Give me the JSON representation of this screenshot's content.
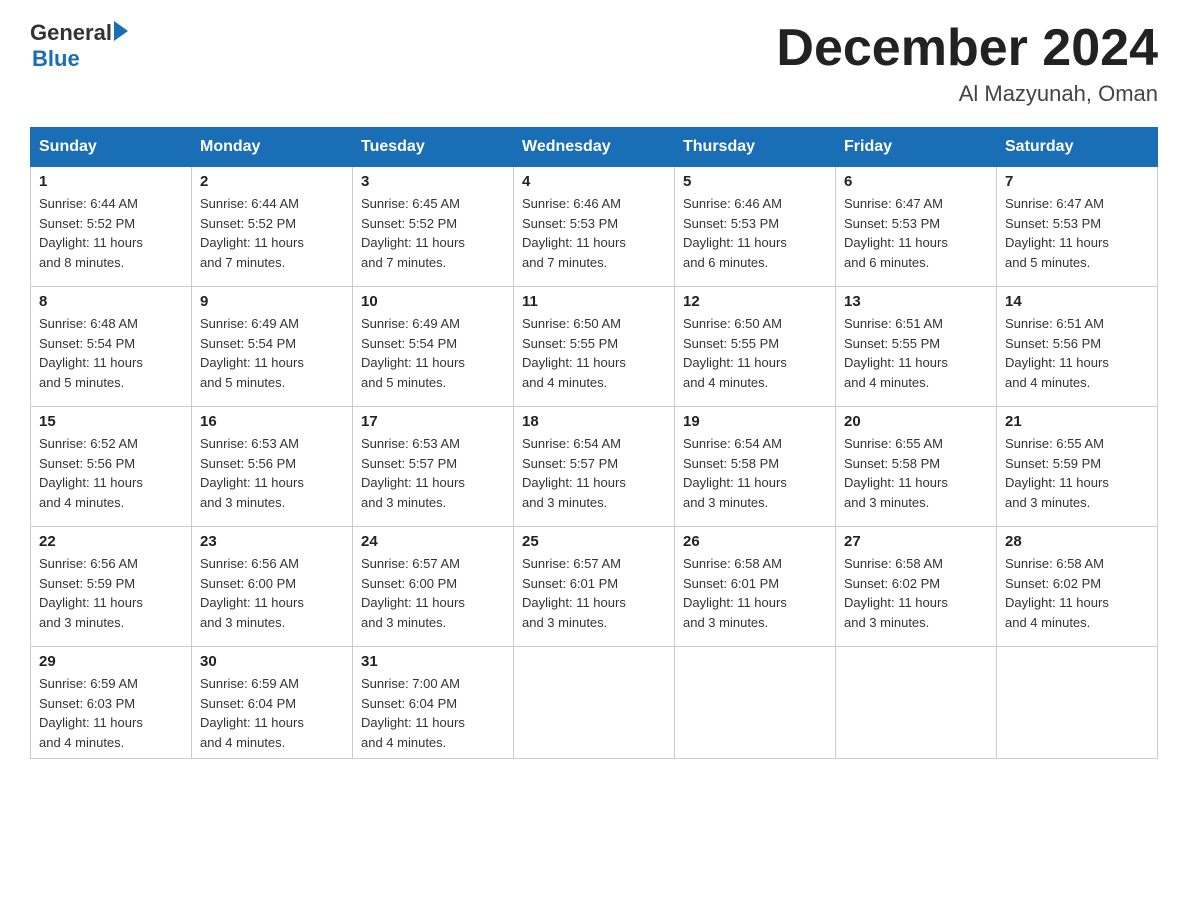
{
  "header": {
    "logo_general": "General",
    "logo_blue": "Blue",
    "main_title": "December 2024",
    "subtitle": "Al Mazyunah, Oman"
  },
  "columns": [
    "Sunday",
    "Monday",
    "Tuesday",
    "Wednesday",
    "Thursday",
    "Friday",
    "Saturday"
  ],
  "weeks": [
    [
      {
        "day": "1",
        "sunrise": "6:44 AM",
        "sunset": "5:52 PM",
        "daylight": "11 hours and 8 minutes."
      },
      {
        "day": "2",
        "sunrise": "6:44 AM",
        "sunset": "5:52 PM",
        "daylight": "11 hours and 7 minutes."
      },
      {
        "day": "3",
        "sunrise": "6:45 AM",
        "sunset": "5:52 PM",
        "daylight": "11 hours and 7 minutes."
      },
      {
        "day": "4",
        "sunrise": "6:46 AM",
        "sunset": "5:53 PM",
        "daylight": "11 hours and 7 minutes."
      },
      {
        "day": "5",
        "sunrise": "6:46 AM",
        "sunset": "5:53 PM",
        "daylight": "11 hours and 6 minutes."
      },
      {
        "day": "6",
        "sunrise": "6:47 AM",
        "sunset": "5:53 PM",
        "daylight": "11 hours and 6 minutes."
      },
      {
        "day": "7",
        "sunrise": "6:47 AM",
        "sunset": "5:53 PM",
        "daylight": "11 hours and 5 minutes."
      }
    ],
    [
      {
        "day": "8",
        "sunrise": "6:48 AM",
        "sunset": "5:54 PM",
        "daylight": "11 hours and 5 minutes."
      },
      {
        "day": "9",
        "sunrise": "6:49 AM",
        "sunset": "5:54 PM",
        "daylight": "11 hours and 5 minutes."
      },
      {
        "day": "10",
        "sunrise": "6:49 AM",
        "sunset": "5:54 PM",
        "daylight": "11 hours and 5 minutes."
      },
      {
        "day": "11",
        "sunrise": "6:50 AM",
        "sunset": "5:55 PM",
        "daylight": "11 hours and 4 minutes."
      },
      {
        "day": "12",
        "sunrise": "6:50 AM",
        "sunset": "5:55 PM",
        "daylight": "11 hours and 4 minutes."
      },
      {
        "day": "13",
        "sunrise": "6:51 AM",
        "sunset": "5:55 PM",
        "daylight": "11 hours and 4 minutes."
      },
      {
        "day": "14",
        "sunrise": "6:51 AM",
        "sunset": "5:56 PM",
        "daylight": "11 hours and 4 minutes."
      }
    ],
    [
      {
        "day": "15",
        "sunrise": "6:52 AM",
        "sunset": "5:56 PM",
        "daylight": "11 hours and 4 minutes."
      },
      {
        "day": "16",
        "sunrise": "6:53 AM",
        "sunset": "5:56 PM",
        "daylight": "11 hours and 3 minutes."
      },
      {
        "day": "17",
        "sunrise": "6:53 AM",
        "sunset": "5:57 PM",
        "daylight": "11 hours and 3 minutes."
      },
      {
        "day": "18",
        "sunrise": "6:54 AM",
        "sunset": "5:57 PM",
        "daylight": "11 hours and 3 minutes."
      },
      {
        "day": "19",
        "sunrise": "6:54 AM",
        "sunset": "5:58 PM",
        "daylight": "11 hours and 3 minutes."
      },
      {
        "day": "20",
        "sunrise": "6:55 AM",
        "sunset": "5:58 PM",
        "daylight": "11 hours and 3 minutes."
      },
      {
        "day": "21",
        "sunrise": "6:55 AM",
        "sunset": "5:59 PM",
        "daylight": "11 hours and 3 minutes."
      }
    ],
    [
      {
        "day": "22",
        "sunrise": "6:56 AM",
        "sunset": "5:59 PM",
        "daylight": "11 hours and 3 minutes."
      },
      {
        "day": "23",
        "sunrise": "6:56 AM",
        "sunset": "6:00 PM",
        "daylight": "11 hours and 3 minutes."
      },
      {
        "day": "24",
        "sunrise": "6:57 AM",
        "sunset": "6:00 PM",
        "daylight": "11 hours and 3 minutes."
      },
      {
        "day": "25",
        "sunrise": "6:57 AM",
        "sunset": "6:01 PM",
        "daylight": "11 hours and 3 minutes."
      },
      {
        "day": "26",
        "sunrise": "6:58 AM",
        "sunset": "6:01 PM",
        "daylight": "11 hours and 3 minutes."
      },
      {
        "day": "27",
        "sunrise": "6:58 AM",
        "sunset": "6:02 PM",
        "daylight": "11 hours and 3 minutes."
      },
      {
        "day": "28",
        "sunrise": "6:58 AM",
        "sunset": "6:02 PM",
        "daylight": "11 hours and 4 minutes."
      }
    ],
    [
      {
        "day": "29",
        "sunrise": "6:59 AM",
        "sunset": "6:03 PM",
        "daylight": "11 hours and 4 minutes."
      },
      {
        "day": "30",
        "sunrise": "6:59 AM",
        "sunset": "6:04 PM",
        "daylight": "11 hours and 4 minutes."
      },
      {
        "day": "31",
        "sunrise": "7:00 AM",
        "sunset": "6:04 PM",
        "daylight": "11 hours and 4 minutes."
      },
      null,
      null,
      null,
      null
    ]
  ]
}
